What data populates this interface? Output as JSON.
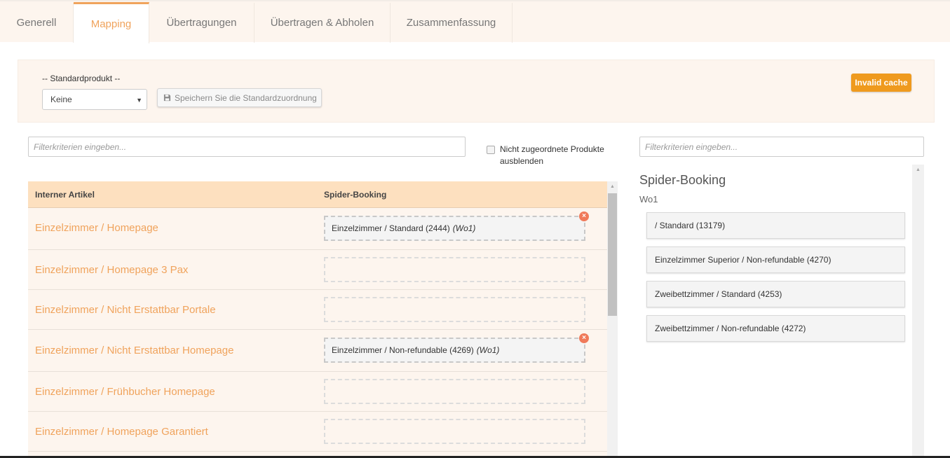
{
  "tabs": [
    "Generell",
    "Mapping",
    "Übertragungen",
    "Übertragen & Abholen",
    "Zusammenfassung"
  ],
  "active_tab": "Mapping",
  "default_product": {
    "label": "-- Standardprodukt --",
    "selected": "Keine",
    "save_label": "Speichern Sie die Standardzuordnung",
    "invalid_cache_label": "Invalid cache"
  },
  "filter_left": {
    "placeholder": "Filterkriterien eingeben..."
  },
  "hide_unmapped": {
    "label": "Nicht zugeordnete Produkte ausblenden",
    "checked": false
  },
  "filter_right": {
    "placeholder": "Filterkriterien eingeben..."
  },
  "table": {
    "col_internal": "Interner Artikel",
    "col_spider": "Spider-Booking",
    "rows": [
      {
        "name": "Einzelzimmer / Homepage",
        "mapped": "Einzelzimmer / Standard (2444)",
        "mapped_tag": "(Wo1)"
      },
      {
        "name": "Einzelzimmer / Homepage 3 Pax",
        "mapped": "",
        "mapped_tag": ""
      },
      {
        "name": "Einzelzimmer / Nicht Erstattbar Portale",
        "mapped": "",
        "mapped_tag": ""
      },
      {
        "name": "Einzelzimmer / Nicht Erstattbar Homepage",
        "mapped": "Einzelzimmer / Non-refundable (4269)",
        "mapped_tag": "(Wo1)"
      },
      {
        "name": "Einzelzimmer / Frühbucher Homepage",
        "mapped": "",
        "mapped_tag": ""
      },
      {
        "name": "Einzelzimmer / Homepage Garantiert",
        "mapped": "",
        "mapped_tag": ""
      }
    ]
  },
  "right_panel": {
    "title": "Spider-Booking",
    "group": "Wo1",
    "items": [
      "/ Standard (13179)",
      "Einzelzimmer Superior / Non-refundable (4270)",
      "Zweibettzimmer / Standard (4253)",
      "Zweibettzimmer / Non-refundable (4272)"
    ]
  },
  "colors": {
    "accent": "#f0a35c",
    "button_orange": "#ef9a1e",
    "panel_bg": "#fdf5ee",
    "header_bg": "#fde0bf"
  },
  "icons": {
    "save": "floppy-disk-icon",
    "remove": "remove-circle-icon",
    "caret": "caret-down-icon"
  }
}
